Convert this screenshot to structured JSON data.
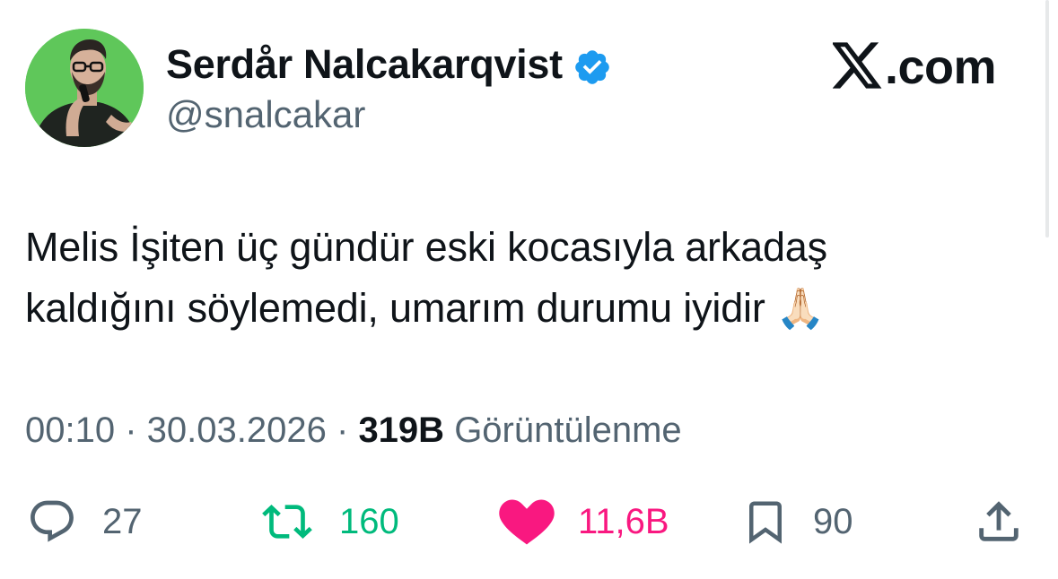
{
  "tweet": {
    "display_name": "Serdår Nalcakarqvist",
    "handle": "@snalcakar",
    "verified": true,
    "text_line_1": "Melis İşiten üç gündür eski kocasıyla arkadaş",
    "text_line_2": "kaldığını söylemedi, umarım durumu iyidir",
    "emoji": "🙏🏻",
    "time": "00:10",
    "date": "30.03.2026",
    "views": "319B",
    "views_label": "Görüntülenme"
  },
  "brand": {
    "logo_icon": "x-logo-icon",
    "suffix": ".com"
  },
  "actions": {
    "replies": "27",
    "retweets": "160",
    "likes": "11,6B",
    "bookmarks": "90"
  },
  "colors": {
    "verified_blue": "#1d9bf0",
    "retweet_green": "#00ba7c",
    "like_pink": "#f91880",
    "secondary_gray": "#536471",
    "avatar_bg": "#5fc75a"
  }
}
